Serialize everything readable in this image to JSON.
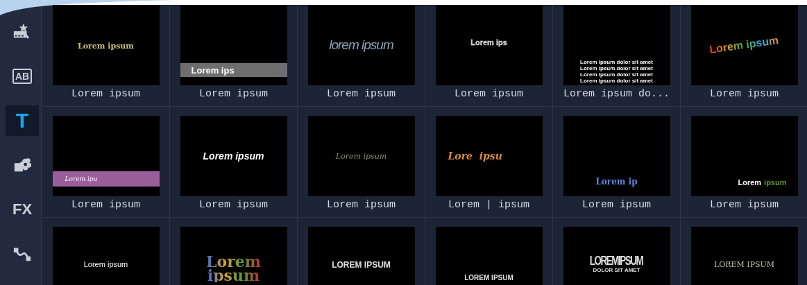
{
  "sidebar": {
    "items": [
      {
        "kind": "magic",
        "selected": false
      },
      {
        "kind": "boxed",
        "label": "AB",
        "selected": false
      },
      {
        "kind": "letter",
        "label": "T",
        "selected": true
      },
      {
        "kind": "shapes",
        "selected": false
      },
      {
        "kind": "letter",
        "label": "FX",
        "selected": false
      },
      {
        "kind": "path",
        "selected": false
      }
    ]
  },
  "templates": [
    {
      "label": "Lorem ipsum",
      "preview": {
        "kind": "gold",
        "text": "Lorem ipsum"
      }
    },
    {
      "label": "Lorem ipsum",
      "preview": {
        "kind": "greybar",
        "text": "Lorem ips"
      }
    },
    {
      "label": "Lorem ipsum",
      "preview": {
        "kind": "thin",
        "text": "lorem ipsum"
      }
    },
    {
      "label": "Lorem ipsum",
      "preview": {
        "kind": "outline",
        "text": "Lorem ips"
      }
    },
    {
      "label": "Lorem ipsum do...",
      "preview": {
        "kind": "lines",
        "lines": [
          "Lorem ipsum dolor sit amet",
          "Lorem ipsum dolor sit amet",
          "Lorem ipsum dolor sit amet",
          "Lorem ipsum dolor sit amet"
        ]
      }
    },
    {
      "label": "Lorem ipsum",
      "preview": {
        "kind": "rainbow",
        "text": "Lorem ipsum"
      }
    },
    {
      "label": "Lorem ipsum",
      "preview": {
        "kind": "purplebar",
        "text": "Lorem ipu"
      }
    },
    {
      "label": "Lorem ipsum",
      "preview": {
        "kind": "bolditalic",
        "text": "Lorem ipsum"
      }
    },
    {
      "label": "Lorem ipsum",
      "preview": {
        "kind": "serifitalic",
        "text": "Lorem ipsum"
      }
    },
    {
      "label": "Lorem | ipsum",
      "preview": {
        "kind": "script",
        "text": "Lore  ipsu"
      }
    },
    {
      "label": "Lorem ipsum",
      "preview": {
        "kind": "blue",
        "text": "Lorem ip"
      }
    },
    {
      "label": "Lorem ipsum",
      "preview": {
        "kind": "twotone",
        "text": "Lorem",
        "accent": "ipsum"
      }
    },
    {
      "preview": {
        "kind": "plain",
        "text": "Lorem ipsum"
      }
    },
    {
      "preview": {
        "kind": "stack",
        "lines": [
          "Lorem",
          "ipsum"
        ]
      }
    },
    {
      "preview": {
        "kind": "caps",
        "text": "LOREM IPSUM"
      }
    },
    {
      "preview": {
        "kind": "capslow",
        "text": "LOREM IPSUM"
      }
    },
    {
      "preview": {
        "kind": "condensed",
        "text": "LOREMIPSUM",
        "sub": "DOLOR SIT AMET"
      }
    },
    {
      "preview": {
        "kind": "serifcaps",
        "text": "LOREM IPSUM"
      }
    }
  ]
}
